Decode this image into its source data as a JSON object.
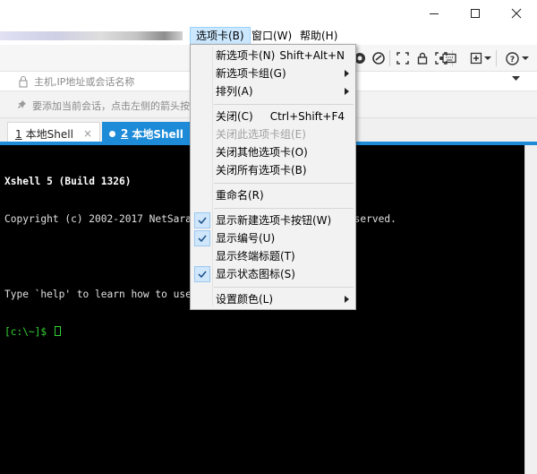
{
  "menubar": {
    "items": [
      {
        "label": "选项卡(B)"
      },
      {
        "label": "窗口(W)"
      },
      {
        "label": "帮助(H)"
      }
    ]
  },
  "address": {
    "placeholder": "主机,IP地址或会话名称"
  },
  "hint": {
    "text": "要添加当前会话，点击左侧的箭头按"
  },
  "tabs": [
    {
      "number": "1",
      "title": "本地Shell"
    },
    {
      "number": "2",
      "title": "本地Shell"
    }
  ],
  "terminal": {
    "lines": [
      "Xshell 5 (Build 1326)",
      "Copyright (c) 2002-2017 NetSarang                       reserved.",
      "",
      "Type `help' to learn how to use",
      "[c:\\~]$ "
    ]
  },
  "tab_menu": {
    "items": [
      {
        "label": "新选项卡(N)",
        "shortcut": "Shift+Alt+N"
      },
      {
        "label": "新选项卡组(G)"
      },
      {
        "label": "排列(A)"
      },
      {
        "label": "关闭(C)",
        "shortcut": "Ctrl+Shift+F4"
      },
      {
        "label": "关闭此选项卡组(E)"
      },
      {
        "label": "关闭其他选项卡(O)"
      },
      {
        "label": "关闭所有选项卡(B)"
      },
      {
        "label": "重命名(R)"
      },
      {
        "label": "显示新建选项卡按钮(W)"
      },
      {
        "label": "显示编号(U)"
      },
      {
        "label": "显示终端标题(T)"
      },
      {
        "label": "显示状态图标(S)"
      },
      {
        "label": "设置颜色(L)"
      }
    ]
  },
  "colors": {
    "accent": "#1d8bd8",
    "menu_highlight": "#cce8ff",
    "terminal_bg": "#000000",
    "prompt_green": "#35d335"
  }
}
